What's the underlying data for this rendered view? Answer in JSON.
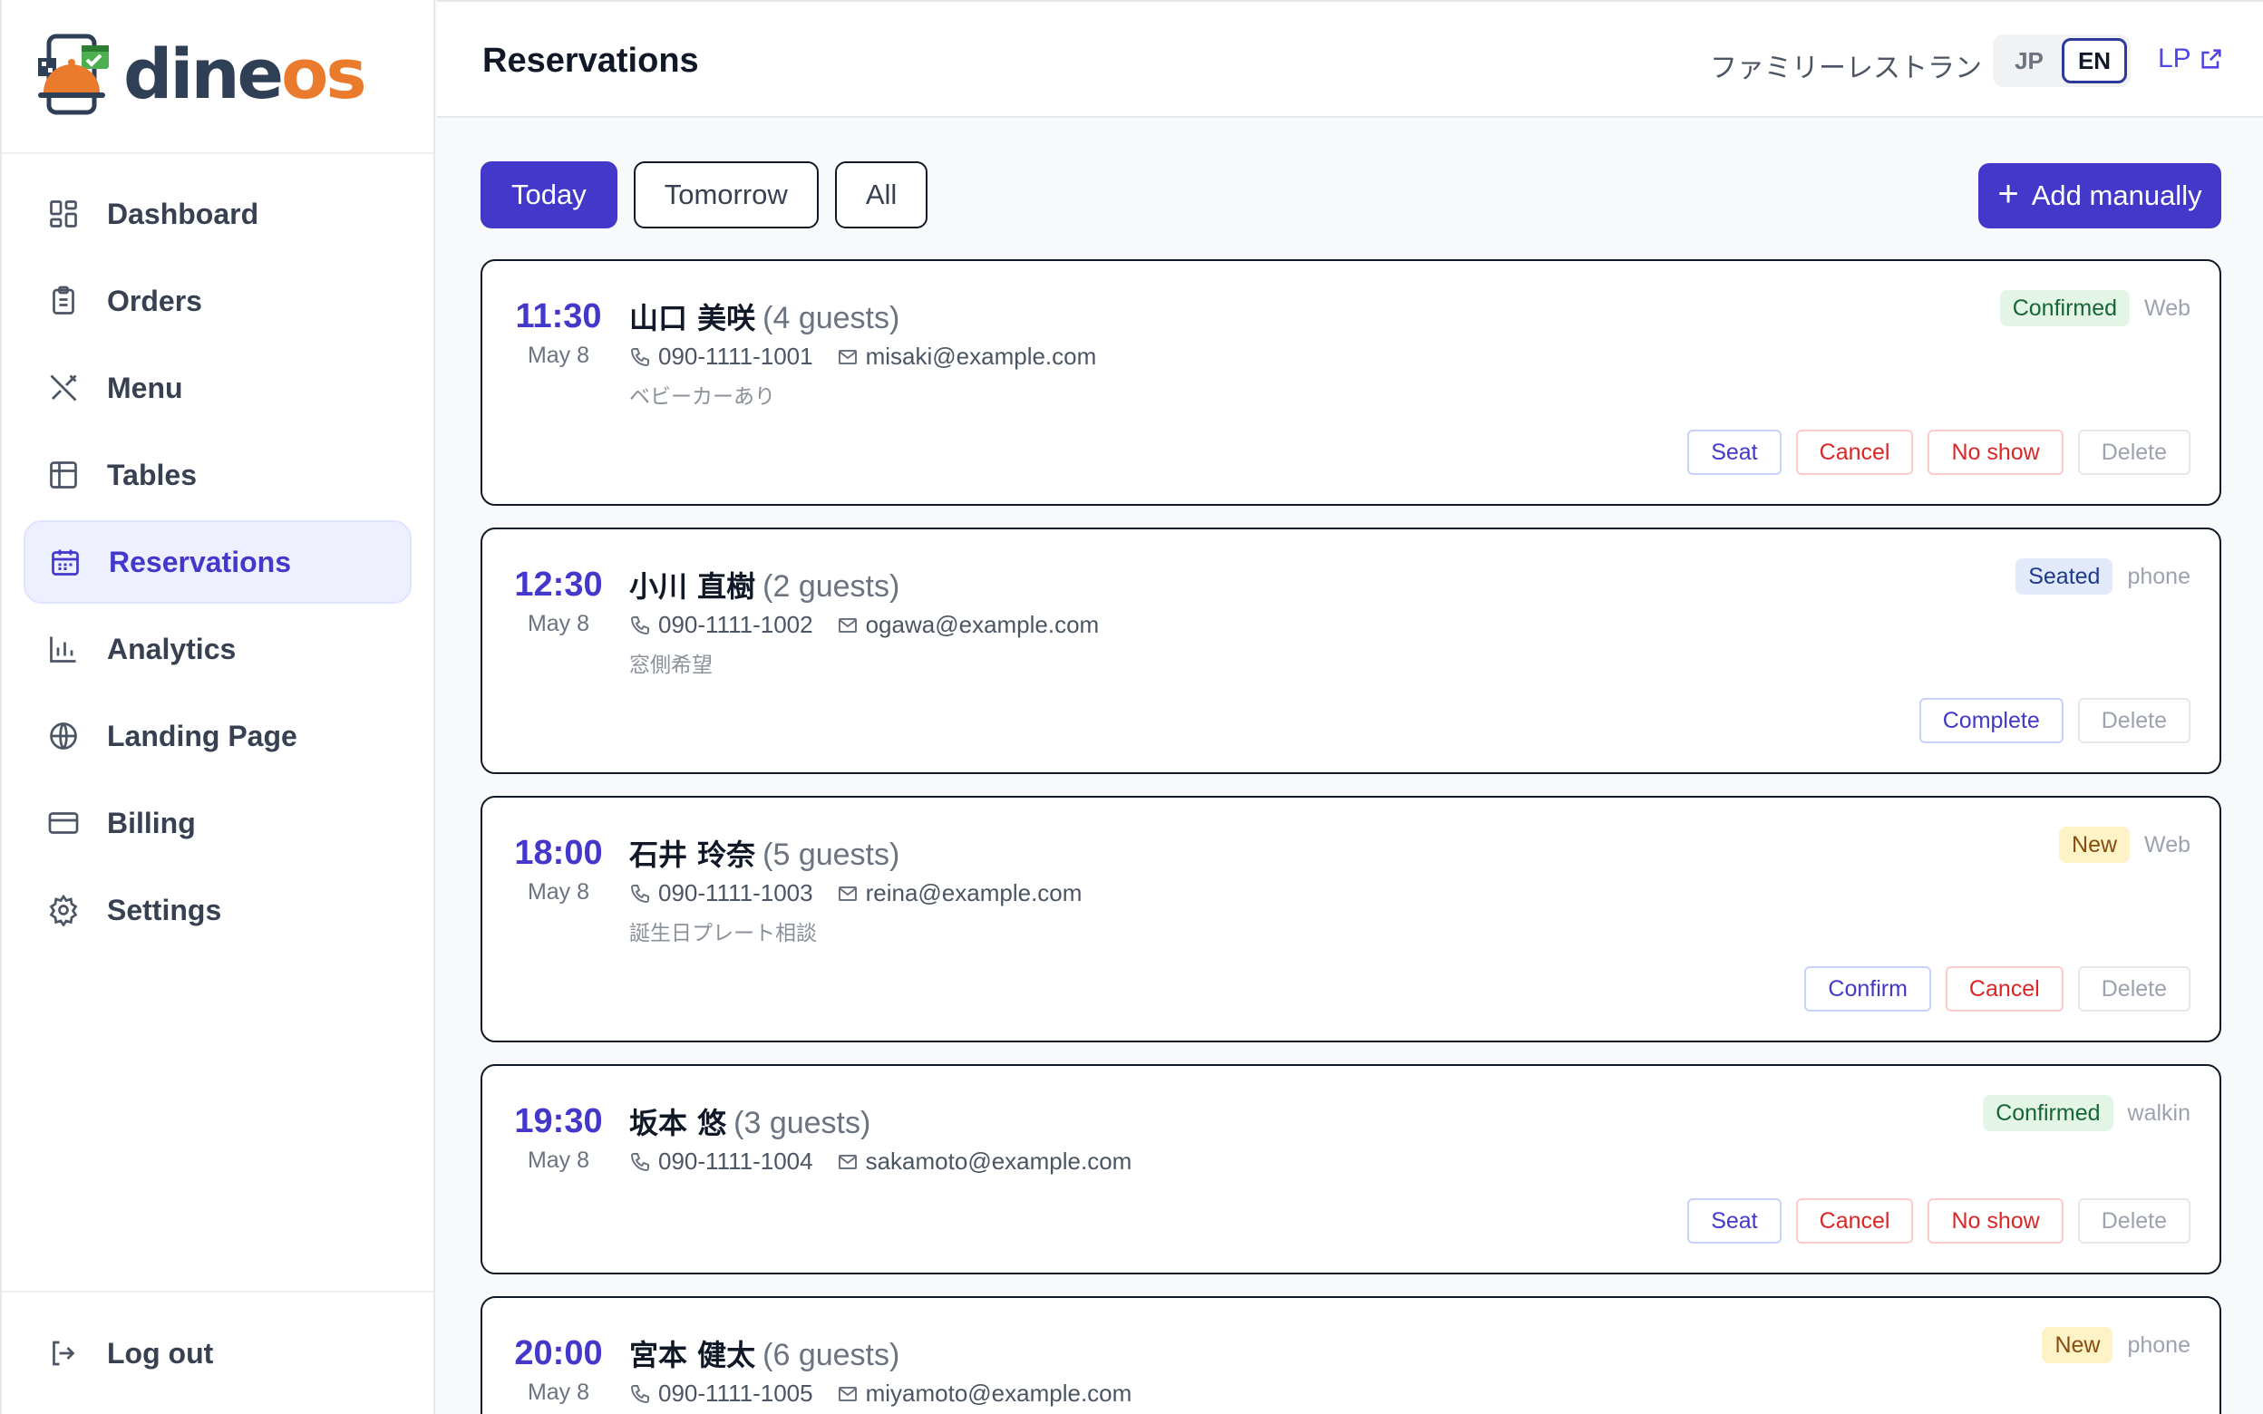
{
  "brand": {
    "name_part1": "dine",
    "name_part2": "os",
    "logo_icon": "restaurant-logo-icon"
  },
  "sidebar": {
    "items": [
      {
        "label": "Dashboard",
        "icon": "dashboard-icon"
      },
      {
        "label": "Orders",
        "icon": "clipboard-icon"
      },
      {
        "label": "Menu",
        "icon": "utensils-icon"
      },
      {
        "label": "Tables",
        "icon": "table-icon"
      },
      {
        "label": "Reservations",
        "icon": "calendar-icon",
        "active": true
      },
      {
        "label": "Analytics",
        "icon": "bar-chart-icon"
      },
      {
        "label": "Landing Page",
        "icon": "globe-icon"
      },
      {
        "label": "Billing",
        "icon": "credit-card-icon"
      },
      {
        "label": "Settings",
        "icon": "gear-icon"
      }
    ],
    "logout": "Log out"
  },
  "header": {
    "title": "Reservations",
    "restaurant": "ファミリーレストラン",
    "lang": {
      "jp": "JP",
      "en": "EN",
      "selected": "EN"
    },
    "lp_link": "LP"
  },
  "filters": {
    "today": "Today",
    "tomorrow": "Tomorrow",
    "all": "All",
    "selected": "Today"
  },
  "add_button": "Add manually",
  "reservations": [
    {
      "time": "11:30",
      "date": "May 8",
      "name": "山口 美咲",
      "guests": "(4 guests)",
      "phone": "090-1111-1001",
      "email": "misaki@example.com",
      "note": "ベビーカーあり",
      "status": "Confirmed",
      "source": "Web",
      "actions": [
        "Seat",
        "Cancel",
        "No show",
        "Delete"
      ]
    },
    {
      "time": "12:30",
      "date": "May 8",
      "name": "小川 直樹",
      "guests": "(2 guests)",
      "phone": "090-1111-1002",
      "email": "ogawa@example.com",
      "note": "窓側希望",
      "status": "Seated",
      "source": "phone",
      "actions": [
        "Complete",
        "Delete"
      ]
    },
    {
      "time": "18:00",
      "date": "May 8",
      "name": "石井 玲奈",
      "guests": "(5 guests)",
      "phone": "090-1111-1003",
      "email": "reina@example.com",
      "note": "誕生日プレート相談",
      "status": "New",
      "source": "Web",
      "actions": [
        "Confirm",
        "Cancel",
        "Delete"
      ]
    },
    {
      "time": "19:30",
      "date": "May 8",
      "name": "坂本 悠",
      "guests": "(3 guests)",
      "phone": "090-1111-1004",
      "email": "sakamoto@example.com",
      "note": "",
      "status": "Confirmed",
      "source": "walkin",
      "actions": [
        "Seat",
        "Cancel",
        "No show",
        "Delete"
      ]
    },
    {
      "time": "20:00",
      "date": "May 8",
      "name": "宮本 健太",
      "guests": "(6 guests)",
      "phone": "090-1111-1005",
      "email": "miyamoto@example.com",
      "note": "",
      "status": "New",
      "source": "phone",
      "actions": []
    }
  ],
  "colors": {
    "accent": "#4338ca",
    "brand_dark": "#2f3f56",
    "brand_orange": "#ea7a2c",
    "danger": "#dc2626"
  }
}
